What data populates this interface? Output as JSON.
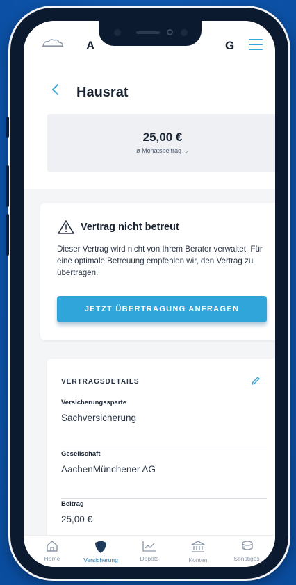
{
  "header": {
    "app_title": "A",
    "app_title_end": "G",
    "logo_icon": "cloud-logo-icon",
    "menu_icon": "hamburger-menu-icon"
  },
  "page": {
    "title": "Hausrat",
    "back_icon": "chevron-left-icon"
  },
  "summary": {
    "amount": "25,00 €",
    "period_label": "ø Monatsbeitrag",
    "period_chevron": "⌄"
  },
  "warning": {
    "title": "Vertrag nicht betreut",
    "text": "Dieser Vertrag wird nicht von Ihrem Berater verwaltet. Für eine optimale Betreuung empfehlen wir, den Vertrag zu übertragen.",
    "cta_label": "JETZT ÜBERTRAGUNG ANFRAGEN"
  },
  "details": {
    "heading": "VERTRAGSDETAILS",
    "fields": [
      {
        "label": "Versicherungssparte",
        "value": "Sachversicherung"
      },
      {
        "label": "Gesellschaft",
        "value": "AachenMünchener AG"
      },
      {
        "label": "Beitrag",
        "value": "25,00 €"
      }
    ]
  },
  "tabbar": {
    "tabs": [
      {
        "label": "Home",
        "icon": "home-icon"
      },
      {
        "label": "Versicherung",
        "icon": "shield-icon",
        "active": true
      },
      {
        "label": "Depots",
        "icon": "chart-icon"
      },
      {
        "label": "Konten",
        "icon": "bank-icon"
      },
      {
        "label": "Sonstiges",
        "icon": "coins-icon"
      }
    ]
  },
  "colors": {
    "accent": "#2fa5d9",
    "background": "#0f5bb4",
    "active_tab": "#1e3a5a"
  }
}
